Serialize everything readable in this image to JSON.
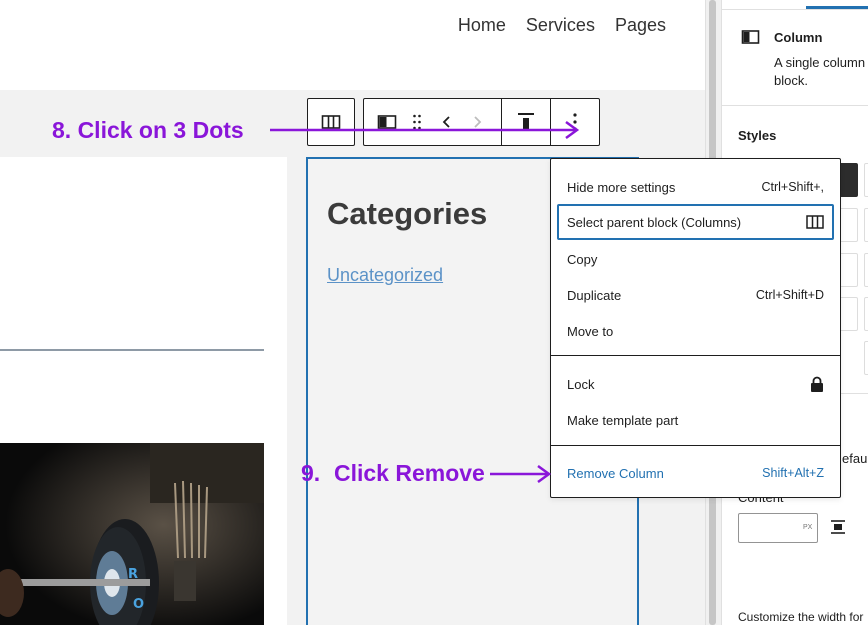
{
  "nav": {
    "items": [
      "Home",
      "Services",
      "Pages"
    ]
  },
  "content": {
    "categories_title": "Categories",
    "categories_link": "Uncategorized"
  },
  "annotations": {
    "step8": "8. Click on 3 Dots",
    "step9_num": "9.",
    "step9_text": "Click Remove"
  },
  "menu": {
    "items": [
      {
        "label": "Hide more settings",
        "shortcut": "Ctrl+Shift+,"
      },
      {
        "label": "Select parent block (Columns)",
        "shortcut": ""
      },
      {
        "label": "Copy",
        "shortcut": ""
      },
      {
        "label": "Duplicate",
        "shortcut": "Ctrl+Shift+D"
      },
      {
        "label": "Move to",
        "shortcut": ""
      },
      {
        "label": "Lock",
        "shortcut": ""
      },
      {
        "label": "Make template part",
        "shortcut": ""
      },
      {
        "label": "Remove Column",
        "shortcut": "Shift+Alt+Z"
      }
    ]
  },
  "sidebar": {
    "block_title": "Column",
    "block_description": "A single column block.",
    "styles_label": "Styles",
    "default_fragment": "efault",
    "content_label": "Content",
    "unit": "PX",
    "footer_text": "Customize the width for"
  },
  "colors": {
    "accent": "#2271b1",
    "annotation": "#8a16d9",
    "toolbar_border": "#1e1e1e"
  }
}
